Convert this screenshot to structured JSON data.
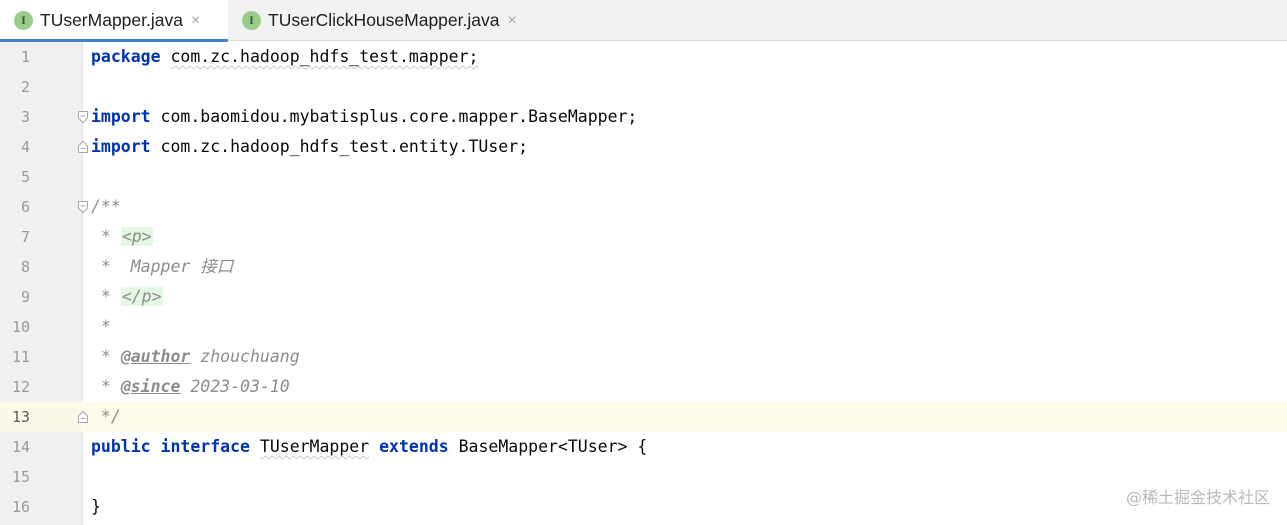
{
  "tabs": [
    {
      "label": "TUserMapper.java",
      "icon": "interface-icon",
      "icon_letter": "I",
      "active": true
    },
    {
      "label": "TUserClickHouseMapper.java",
      "icon": "interface-icon",
      "icon_letter": "I",
      "active": false
    }
  ],
  "close_glyph": "×",
  "line_numbers": [
    "1",
    "2",
    "3",
    "4",
    "5",
    "6",
    "7",
    "8",
    "9",
    "10",
    "11",
    "12",
    "13",
    "14",
    "15",
    "16"
  ],
  "current_line": "13",
  "code": {
    "l1_kw": "package",
    "l1_rest": "com.zc.hadoop_hdfs_test.mapper;",
    "l3_kw": "import",
    "l3_rest": "com.baomidou.mybatisplus.core.mapper.BaseMapper;",
    "l4_kw": "import",
    "l4_rest": "com.zc.hadoop_hdfs_test.entity.TUser;",
    "l6": "/**",
    "l7_star": " * ",
    "l7_tag": "<p>",
    "l8": " *  Mapper 接口",
    "l9_star": " * ",
    "l9_tag": "</p>",
    "l10": " *",
    "l11_star": " * ",
    "l11_tag": "@author",
    "l11_val": "zhouchuang",
    "l12_star": " * ",
    "l12_tag": "@since",
    "l12_val": "2023-03-10",
    "l13": " */",
    "l14_kw1": "public",
    "l14_kw2": "interface",
    "l14_name": "TUserMapper",
    "l14_kw3": "extends",
    "l14_rest": "BaseMapper<TUser> {",
    "l16": "}"
  },
  "watermark": "@稀土掘金技术社区",
  "colors": {
    "keyword": "#0033b3",
    "comment": "#8c8c8c",
    "tab_underline": "#4083c9",
    "current_line": "#fdfae8"
  }
}
